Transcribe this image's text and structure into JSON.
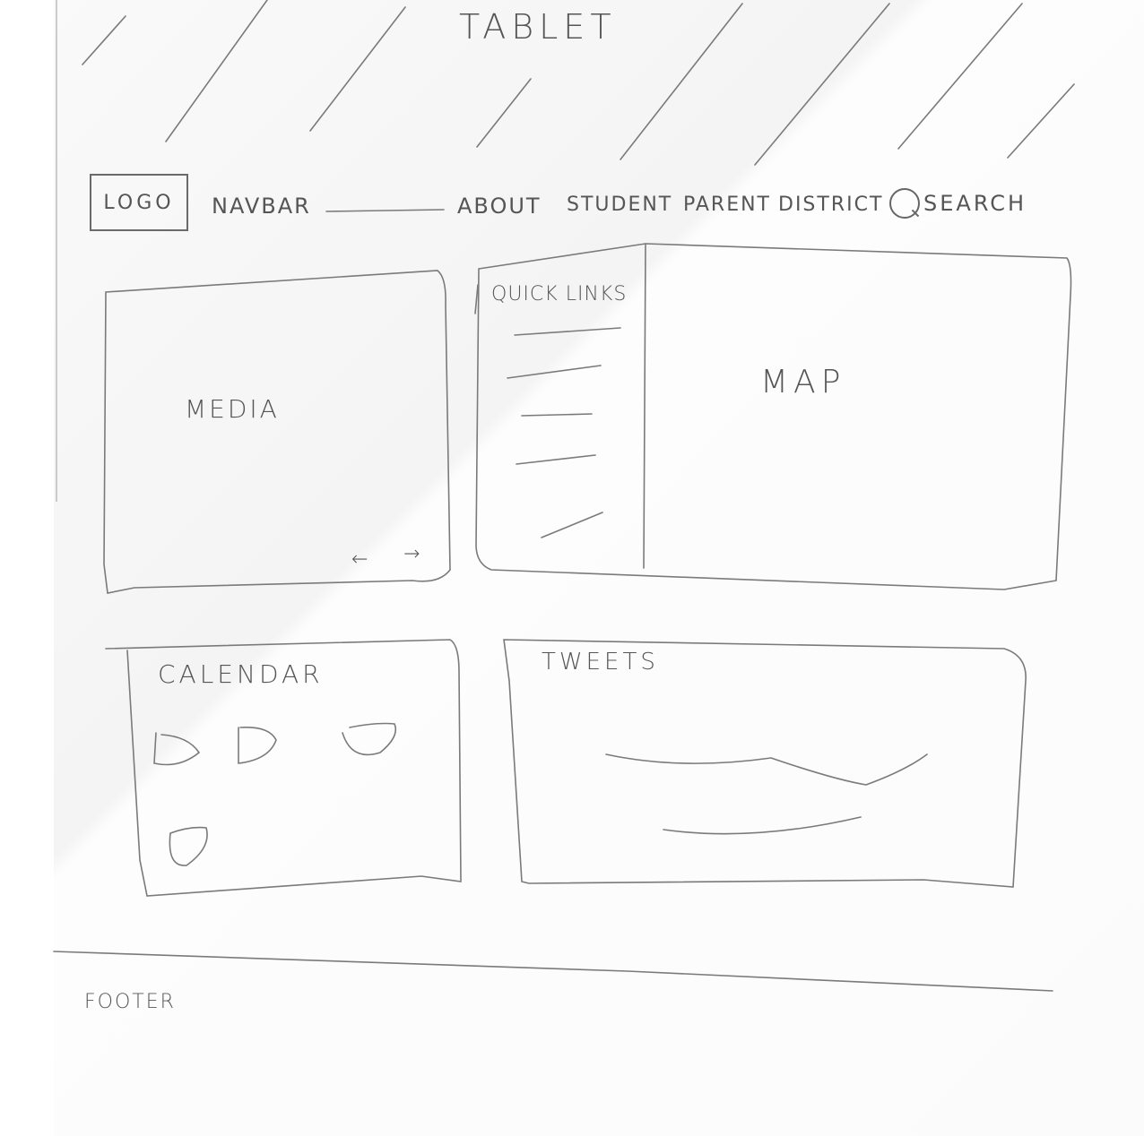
{
  "page": {
    "title": "TABLET"
  },
  "navbar": {
    "logo": "LOGO",
    "label": "NAVBAR",
    "links": [
      "ABOUT",
      "STUDENT",
      "PARENT",
      "DISTRICT"
    ],
    "search": "SEARCH",
    "search_icon": "search-icon"
  },
  "media": {
    "label": "MEDIA",
    "prev_arrow": "←",
    "next_arrow": "→"
  },
  "quick_links": {
    "label": "QUICK LINKS"
  },
  "map": {
    "label": "MAP"
  },
  "calendar": {
    "label": "CALENDAR"
  },
  "tweets": {
    "label": "TWEETS"
  },
  "footer": {
    "label": "FOOTER"
  }
}
